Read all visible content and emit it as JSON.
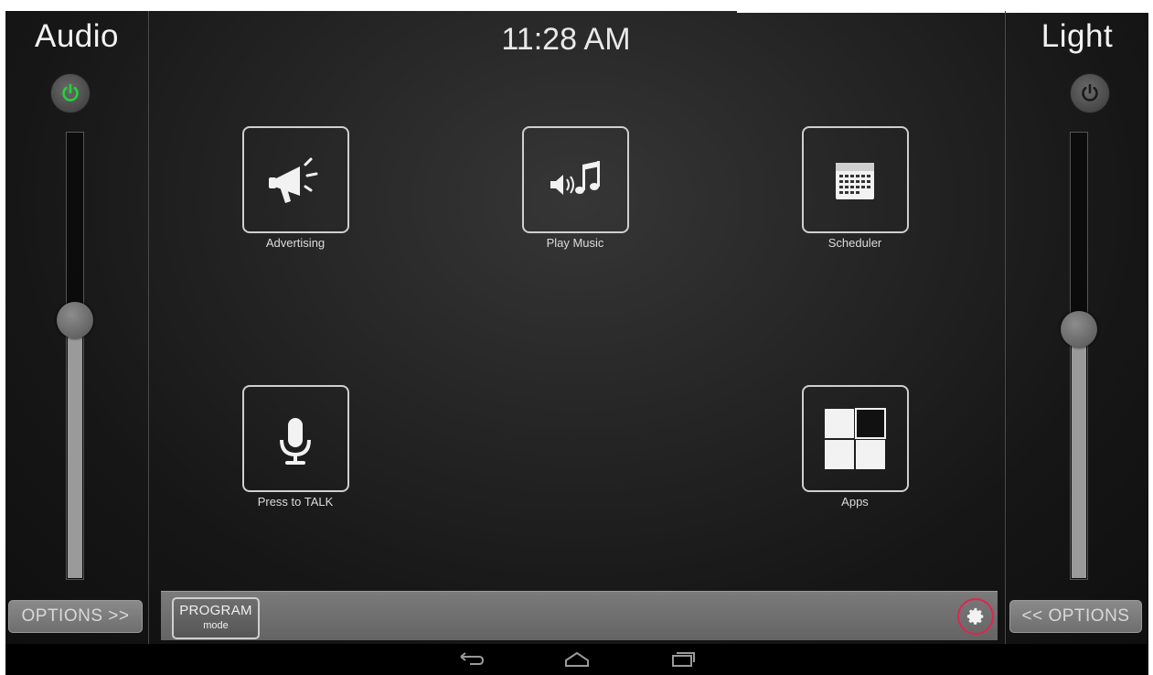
{
  "clock": "11:28 AM",
  "audio": {
    "title": "Audio",
    "power_state": "on",
    "power_color": "#22d43a",
    "level": 0.58,
    "options_label": "OPTIONS >>"
  },
  "light": {
    "title": "Light",
    "power_state": "off",
    "power_color": "#1a1a1a",
    "level": 0.56,
    "options_label": "<< OPTIONS"
  },
  "tiles": [
    {
      "label": "Advertising",
      "icon": "megaphone-icon"
    },
    {
      "label": "Play Music",
      "icon": "music-icon"
    },
    {
      "label": "Scheduler",
      "icon": "calendar-icon"
    },
    {
      "label": "Press to TALK",
      "icon": "microphone-icon"
    },
    {
      "label": "Apps",
      "icon": "apps-grid-icon"
    }
  ],
  "bottom_bar": {
    "program_title": "PROGRAM",
    "program_sub": "mode",
    "settings_icon": "gear-icon",
    "settings_highlight": "#e02450"
  },
  "nav": {
    "back_icon": "back-icon",
    "home_icon": "home-icon",
    "recent_icon": "recent-apps-icon"
  }
}
